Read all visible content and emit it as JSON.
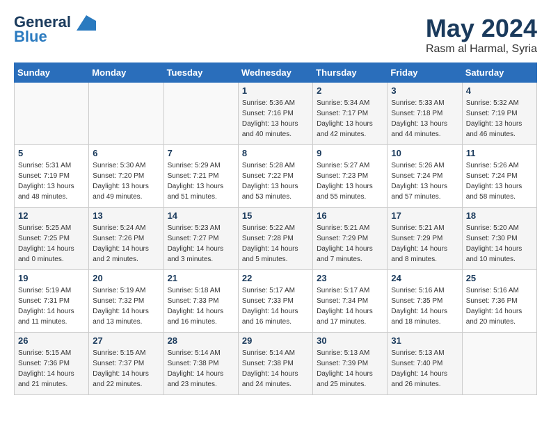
{
  "header": {
    "logo_line1": "General",
    "logo_line2": "Blue",
    "month": "May 2024",
    "location": "Rasm al Harmal, Syria"
  },
  "weekdays": [
    "Sunday",
    "Monday",
    "Tuesday",
    "Wednesday",
    "Thursday",
    "Friday",
    "Saturday"
  ],
  "weeks": [
    [
      {
        "day": "",
        "sunrise": "",
        "sunset": "",
        "daylight": ""
      },
      {
        "day": "",
        "sunrise": "",
        "sunset": "",
        "daylight": ""
      },
      {
        "day": "",
        "sunrise": "",
        "sunset": "",
        "daylight": ""
      },
      {
        "day": "1",
        "sunrise": "Sunrise: 5:36 AM",
        "sunset": "Sunset: 7:16 PM",
        "daylight": "Daylight: 13 hours and 40 minutes."
      },
      {
        "day": "2",
        "sunrise": "Sunrise: 5:34 AM",
        "sunset": "Sunset: 7:17 PM",
        "daylight": "Daylight: 13 hours and 42 minutes."
      },
      {
        "day": "3",
        "sunrise": "Sunrise: 5:33 AM",
        "sunset": "Sunset: 7:18 PM",
        "daylight": "Daylight: 13 hours and 44 minutes."
      },
      {
        "day": "4",
        "sunrise": "Sunrise: 5:32 AM",
        "sunset": "Sunset: 7:19 PM",
        "daylight": "Daylight: 13 hours and 46 minutes."
      }
    ],
    [
      {
        "day": "5",
        "sunrise": "Sunrise: 5:31 AM",
        "sunset": "Sunset: 7:19 PM",
        "daylight": "Daylight: 13 hours and 48 minutes."
      },
      {
        "day": "6",
        "sunrise": "Sunrise: 5:30 AM",
        "sunset": "Sunset: 7:20 PM",
        "daylight": "Daylight: 13 hours and 49 minutes."
      },
      {
        "day": "7",
        "sunrise": "Sunrise: 5:29 AM",
        "sunset": "Sunset: 7:21 PM",
        "daylight": "Daylight: 13 hours and 51 minutes."
      },
      {
        "day": "8",
        "sunrise": "Sunrise: 5:28 AM",
        "sunset": "Sunset: 7:22 PM",
        "daylight": "Daylight: 13 hours and 53 minutes."
      },
      {
        "day": "9",
        "sunrise": "Sunrise: 5:27 AM",
        "sunset": "Sunset: 7:23 PM",
        "daylight": "Daylight: 13 hours and 55 minutes."
      },
      {
        "day": "10",
        "sunrise": "Sunrise: 5:26 AM",
        "sunset": "Sunset: 7:24 PM",
        "daylight": "Daylight: 13 hours and 57 minutes."
      },
      {
        "day": "11",
        "sunrise": "Sunrise: 5:26 AM",
        "sunset": "Sunset: 7:24 PM",
        "daylight": "Daylight: 13 hours and 58 minutes."
      }
    ],
    [
      {
        "day": "12",
        "sunrise": "Sunrise: 5:25 AM",
        "sunset": "Sunset: 7:25 PM",
        "daylight": "Daylight: 14 hours and 0 minutes."
      },
      {
        "day": "13",
        "sunrise": "Sunrise: 5:24 AM",
        "sunset": "Sunset: 7:26 PM",
        "daylight": "Daylight: 14 hours and 2 minutes."
      },
      {
        "day": "14",
        "sunrise": "Sunrise: 5:23 AM",
        "sunset": "Sunset: 7:27 PM",
        "daylight": "Daylight: 14 hours and 3 minutes."
      },
      {
        "day": "15",
        "sunrise": "Sunrise: 5:22 AM",
        "sunset": "Sunset: 7:28 PM",
        "daylight": "Daylight: 14 hours and 5 minutes."
      },
      {
        "day": "16",
        "sunrise": "Sunrise: 5:21 AM",
        "sunset": "Sunset: 7:29 PM",
        "daylight": "Daylight: 14 hours and 7 minutes."
      },
      {
        "day": "17",
        "sunrise": "Sunrise: 5:21 AM",
        "sunset": "Sunset: 7:29 PM",
        "daylight": "Daylight: 14 hours and 8 minutes."
      },
      {
        "day": "18",
        "sunrise": "Sunrise: 5:20 AM",
        "sunset": "Sunset: 7:30 PM",
        "daylight": "Daylight: 14 hours and 10 minutes."
      }
    ],
    [
      {
        "day": "19",
        "sunrise": "Sunrise: 5:19 AM",
        "sunset": "Sunset: 7:31 PM",
        "daylight": "Daylight: 14 hours and 11 minutes."
      },
      {
        "day": "20",
        "sunrise": "Sunrise: 5:19 AM",
        "sunset": "Sunset: 7:32 PM",
        "daylight": "Daylight: 14 hours and 13 minutes."
      },
      {
        "day": "21",
        "sunrise": "Sunrise: 5:18 AM",
        "sunset": "Sunset: 7:33 PM",
        "daylight": "Daylight: 14 hours and 16 minutes."
      },
      {
        "day": "22",
        "sunrise": "Sunrise: 5:17 AM",
        "sunset": "Sunset: 7:33 PM",
        "daylight": "Daylight: 14 hours and 16 minutes."
      },
      {
        "day": "23",
        "sunrise": "Sunrise: 5:17 AM",
        "sunset": "Sunset: 7:34 PM",
        "daylight": "Daylight: 14 hours and 17 minutes."
      },
      {
        "day": "24",
        "sunrise": "Sunrise: 5:16 AM",
        "sunset": "Sunset: 7:35 PM",
        "daylight": "Daylight: 14 hours and 18 minutes."
      },
      {
        "day": "25",
        "sunrise": "Sunrise: 5:16 AM",
        "sunset": "Sunset: 7:36 PM",
        "daylight": "Daylight: 14 hours and 20 minutes."
      }
    ],
    [
      {
        "day": "26",
        "sunrise": "Sunrise: 5:15 AM",
        "sunset": "Sunset: 7:36 PM",
        "daylight": "Daylight: 14 hours and 21 minutes."
      },
      {
        "day": "27",
        "sunrise": "Sunrise: 5:15 AM",
        "sunset": "Sunset: 7:37 PM",
        "daylight": "Daylight: 14 hours and 22 minutes."
      },
      {
        "day": "28",
        "sunrise": "Sunrise: 5:14 AM",
        "sunset": "Sunset: 7:38 PM",
        "daylight": "Daylight: 14 hours and 23 minutes."
      },
      {
        "day": "29",
        "sunrise": "Sunrise: 5:14 AM",
        "sunset": "Sunset: 7:38 PM",
        "daylight": "Daylight: 14 hours and 24 minutes."
      },
      {
        "day": "30",
        "sunrise": "Sunrise: 5:13 AM",
        "sunset": "Sunset: 7:39 PM",
        "daylight": "Daylight: 14 hours and 25 minutes."
      },
      {
        "day": "31",
        "sunrise": "Sunrise: 5:13 AM",
        "sunset": "Sunset: 7:40 PM",
        "daylight": "Daylight: 14 hours and 26 minutes."
      },
      {
        "day": "",
        "sunrise": "",
        "sunset": "",
        "daylight": ""
      }
    ]
  ]
}
